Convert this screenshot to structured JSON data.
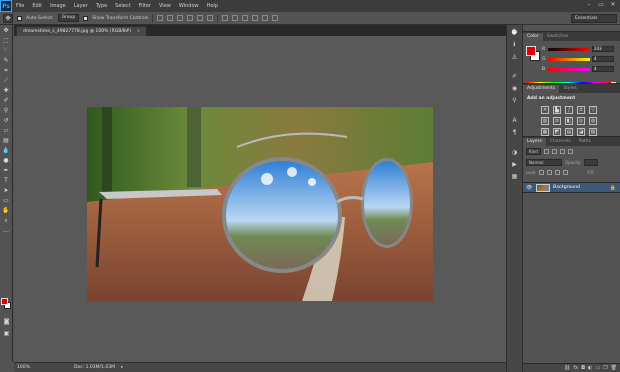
{
  "app": {
    "logo": "Ps"
  },
  "menu": [
    "File",
    "Edit",
    "Image",
    "Layer",
    "Type",
    "Select",
    "Filter",
    "View",
    "Window",
    "Help"
  ],
  "window_controls": {
    "minimize": "–",
    "restore": "▭",
    "close": "✕"
  },
  "options": {
    "auto_select_label": "Auto-Select:",
    "auto_select_value": "Group",
    "show_transform_label": "Show Transform Controls",
    "workspace": "Essentials"
  },
  "document": {
    "tab_title": "dreamstime_s_49827778.jpg @ 100% (RGB/8#)",
    "tab_close": "×",
    "zoom": "100%",
    "doc_size": "Doc: 1.03M/1.03M",
    "status_arrow": "▸"
  },
  "color_panel": {
    "tabs": [
      "Color",
      "Swatches"
    ],
    "fg_color": "#e10000",
    "bg_color": "#ffffff",
    "channels": [
      {
        "label": "R",
        "value": "243"
      },
      {
        "label": "G",
        "value": "4"
      },
      {
        "label": "B",
        "value": "4"
      }
    ]
  },
  "adjustments_panel": {
    "tabs": [
      "Adjustments",
      "Styles"
    ],
    "title": "Add an adjustment",
    "icons": [
      "brightness-contrast-icon",
      "levels-icon",
      "curves-icon",
      "exposure-icon",
      "vibrance-icon",
      "hue-saturation-icon",
      "color-balance-icon",
      "black-white-icon",
      "photo-filter-icon",
      "channel-mixer-icon",
      "color-lookup-icon",
      "invert-icon",
      "posterize-icon",
      "threshold-icon",
      "gradient-map-icon"
    ]
  },
  "layers_panel": {
    "tabs": [
      "Layers",
      "Channels",
      "Paths"
    ],
    "kind_label": "Kind",
    "blend_mode": "Normal",
    "opacity_label": "Opacity:",
    "opacity_value": "",
    "lock_label": "Lock:",
    "fill_label": "Fill:",
    "layer_name": "Background"
  },
  "colors": {
    "accent_blue": "#31a8ff",
    "selected_layer": "#3e5877",
    "foreground": "#e10000"
  }
}
